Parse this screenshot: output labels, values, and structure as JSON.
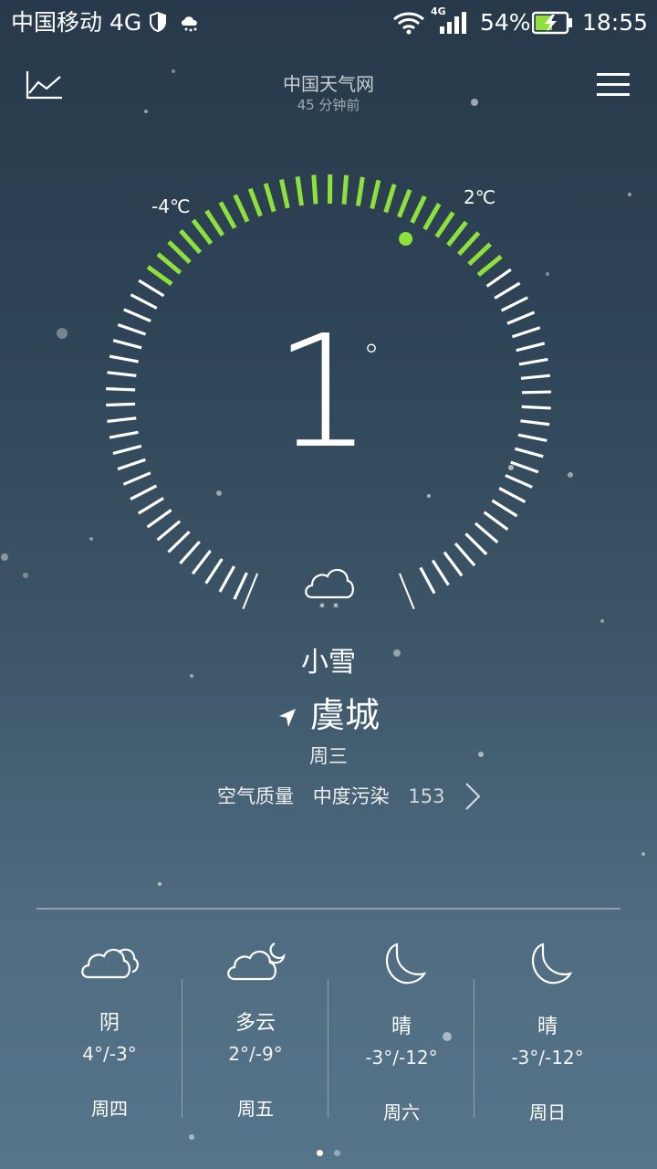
{
  "status_bar": {
    "carrier": "中国移动 4G",
    "network_badge": "4G",
    "battery": "54%",
    "time": "18:55",
    "icons": [
      "shield-icon",
      "weather-snow-icon",
      "wifi-icon",
      "signal-icon",
      "battery-charging-icon"
    ]
  },
  "header": {
    "title": "中国天气网",
    "updated": "45 分钟前",
    "left_icon": "trend-chart-icon",
    "right_icon": "menu-icon"
  },
  "current": {
    "temperature": "1",
    "degree_symbol": "°",
    "low_label": "-4℃",
    "high_label": "2℃",
    "condition": "小雪",
    "condition_icon": "light-snow-icon",
    "location_icon": "location-arrow-icon",
    "city": "虞城",
    "weekday": "周三",
    "accent_color": "#8fe03a",
    "air_quality": {
      "label": "空气质量",
      "level": "中度污染",
      "value": "153"
    }
  },
  "forecast": [
    {
      "condition": "阴",
      "temp": "4°/-3°",
      "day": "周四",
      "icon": "overcast-icon"
    },
    {
      "condition": "多云",
      "temp": "2°/-9°",
      "day": "周五",
      "icon": "cloudy-night-icon"
    },
    {
      "condition": "晴",
      "temp": "-3°/-12°",
      "day": "周六",
      "icon": "clear-night-icon"
    },
    {
      "condition": "晴",
      "temp": "-3°/-12°",
      "day": "周日",
      "icon": "clear-night-icon"
    }
  ],
  "pager": {
    "pages": 2,
    "active": 1
  }
}
